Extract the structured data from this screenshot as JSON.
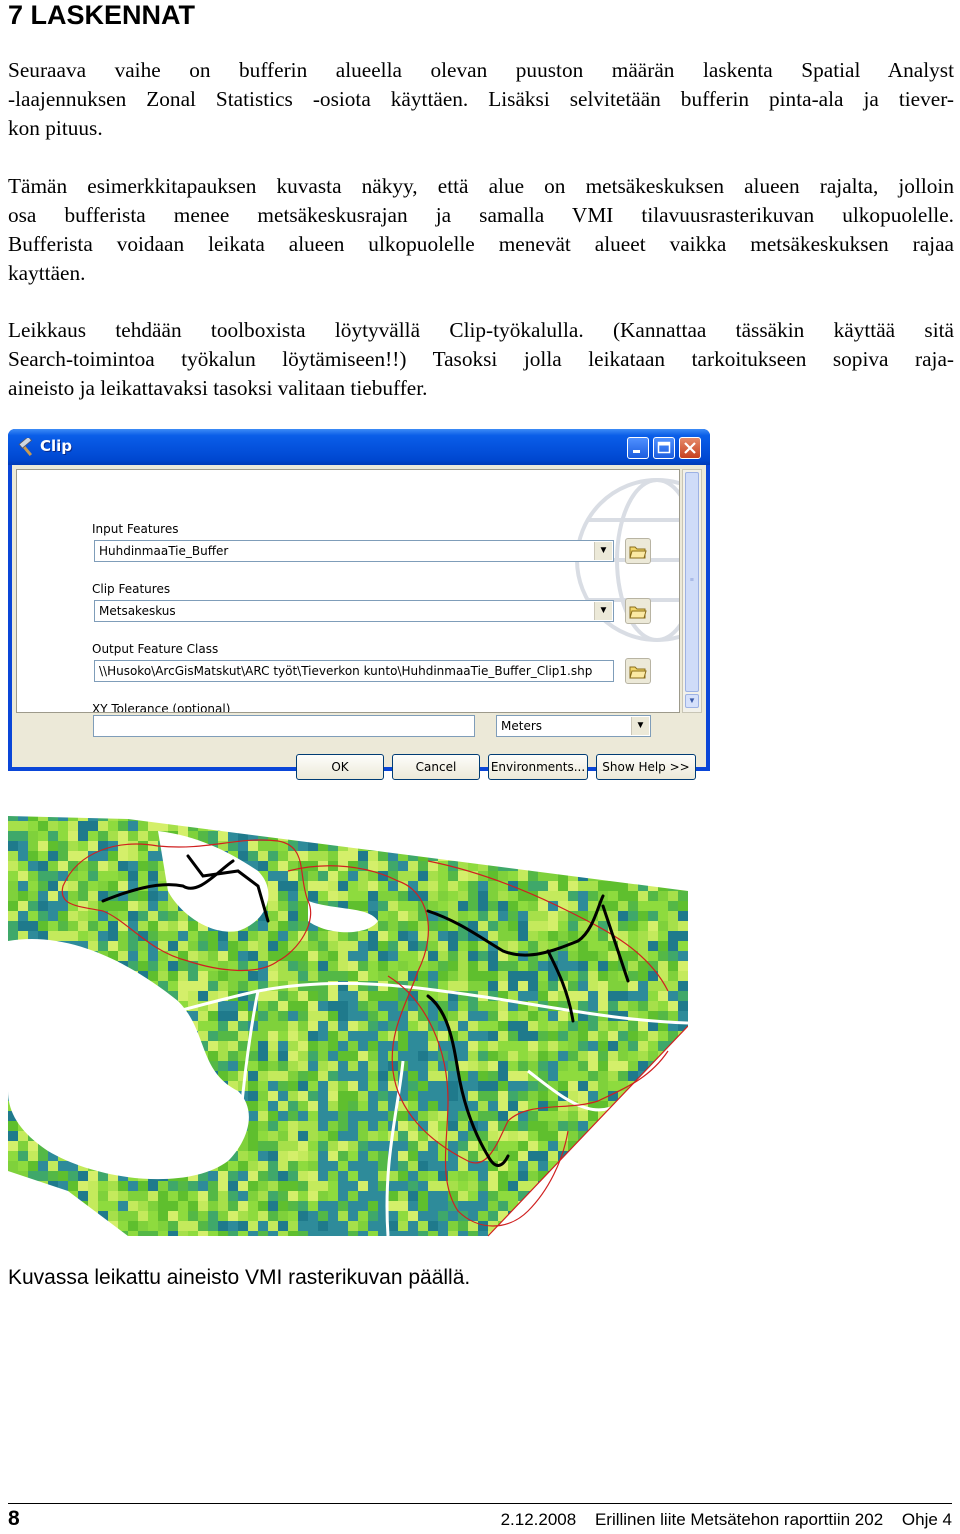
{
  "heading": "7 LASKENNAT",
  "paragraphs": {
    "p1": [
      "Seuraava vaihe on bufferin alueella olevan puuston määrän laskenta Spatial Analyst",
      "-laajennuksen Zonal Statistics -osiota käyttäen. Lisäksi selvitetään bufferin pinta-ala ja tiever-",
      "kon pituus."
    ],
    "p2": [
      "Tämän esimerkkitapauksen kuvasta näkyy, että alue on metsäkeskuksen alueen rajalta, jolloin",
      "osa bufferista menee metsäkeskusrajan ja samalla VMI tilavuusrasterikuvan ulkopuolelle.",
      "Bufferista voidaan leikata alueen ulkopuolelle menevät alueet vaikka metsäkeskuksen rajaa",
      "kayttäen."
    ],
    "p3": [
      "Leikkaus tehdään toolboxista löytyvällä Clip-työkalulla. (Kannattaa tässäkin käyttää sitä",
      "Search-toimintoa työkalun löytämiseen!!) Tasoksi jolla leikataan tarkoitukseen sopiva raja-",
      "aineisto ja leikattavaksi tasoksi valitaan tiebuffer."
    ]
  },
  "dialog": {
    "title": "Clip",
    "input_features_label": "Input Features",
    "input_features_value": "HuhdinmaaTie_Buffer",
    "clip_features_label": "Clip Features",
    "clip_features_value": "Metsakeskus",
    "output_label": "Output Feature Class",
    "output_value": "\\\\Husoko\\ArcGisMatskut\\ARC työt\\Tieverkon kunto\\HuhdinmaaTie_Buffer_Clip1.shp",
    "xy_label": "XY Tolerance (optional)",
    "xy_value": "",
    "units_value": "Meters",
    "ok_label": "OK",
    "cancel_label": "Cancel",
    "environments_label": "Environments...",
    "show_help_label": "Show Help >>",
    "icons": [
      "hammer-icon",
      "open-folder-icon",
      "minimize-icon",
      "maximize-icon",
      "close-icon"
    ]
  },
  "caption": "Kuvassa leikattu aineisto VMI rasterikuvan päällä.",
  "footer": {
    "page_number": "8",
    "date": "2.12.2008",
    "report": "Erillinen liite Metsätehon raporttiin 202",
    "guide": "Ohje 4"
  },
  "colors": {
    "titlebar": "#0553de",
    "dialog_face": "#ece9d8",
    "raster_green": "#66cc33",
    "raster_blue": "#2e8b9a",
    "raster_yellow": "#d9f266",
    "boundary_red": "#d02020"
  }
}
